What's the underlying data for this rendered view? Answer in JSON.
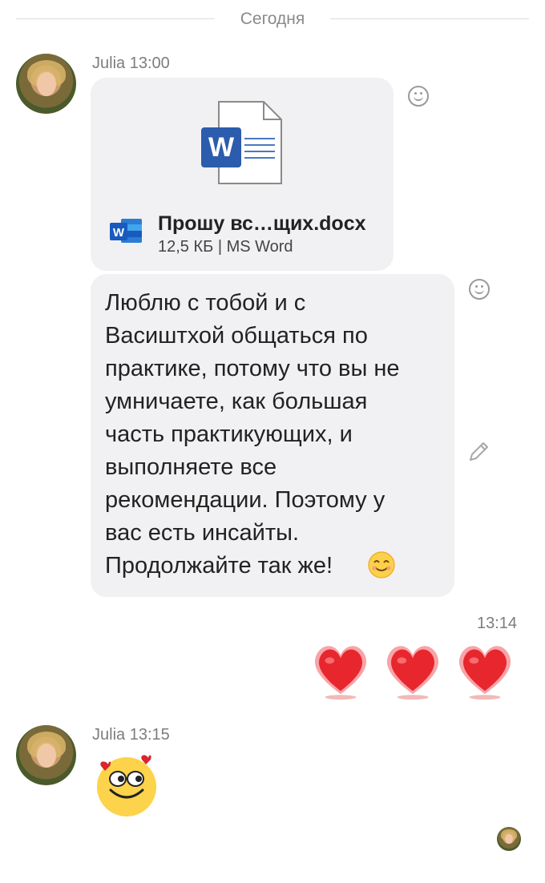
{
  "date_divider": "Сегодня",
  "messages": [
    {
      "sender": "Julia",
      "time": "13:00",
      "file": {
        "name": "Прошу вс…щих.docx",
        "size": "12,5 КБ",
        "type": "MS Word",
        "icon": "word-document-icon"
      },
      "text": "Люблю с тобой и с\nВасиштхой  общаться по\nпрактике, потому что вы не\nумничаете, как большая\nчасть практикующих,  и\nвыполняете все\nрекомендации. Поэтому у\nвас есть инсайты.\nПродолжайте  так же!"
    },
    {
      "time": "13:14",
      "content": "three-hearts",
      "heart_color": "#e8262e"
    },
    {
      "sender": "Julia",
      "time": "13:15",
      "content": "smiley-with-hearts-sticker"
    }
  ],
  "separator": " | "
}
